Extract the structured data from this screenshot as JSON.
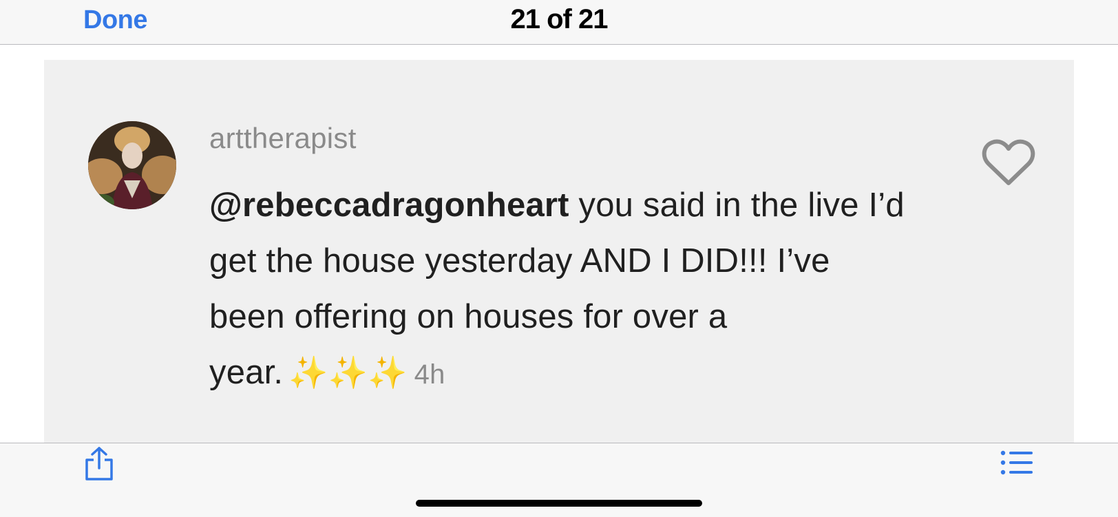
{
  "header": {
    "done_label": "Done",
    "counter": "21 of 21"
  },
  "comment": {
    "username": "arttherapist",
    "mention": "@rebeccadragonheart",
    "text": " you said in the live I’d get the house yesterday AND I DID!!! I’ve been offering on houses for over a year.",
    "emoji": "✨✨✨",
    "time_ago": "4h"
  },
  "colors": {
    "accent": "#3478e6",
    "bar_background": "#f7f7f7",
    "card_background": "#f0f0f0",
    "muted_text": "#8a8a8a"
  },
  "icons": {
    "like": "heart-outline-icon",
    "share": "share-icon",
    "list": "list-icon"
  }
}
